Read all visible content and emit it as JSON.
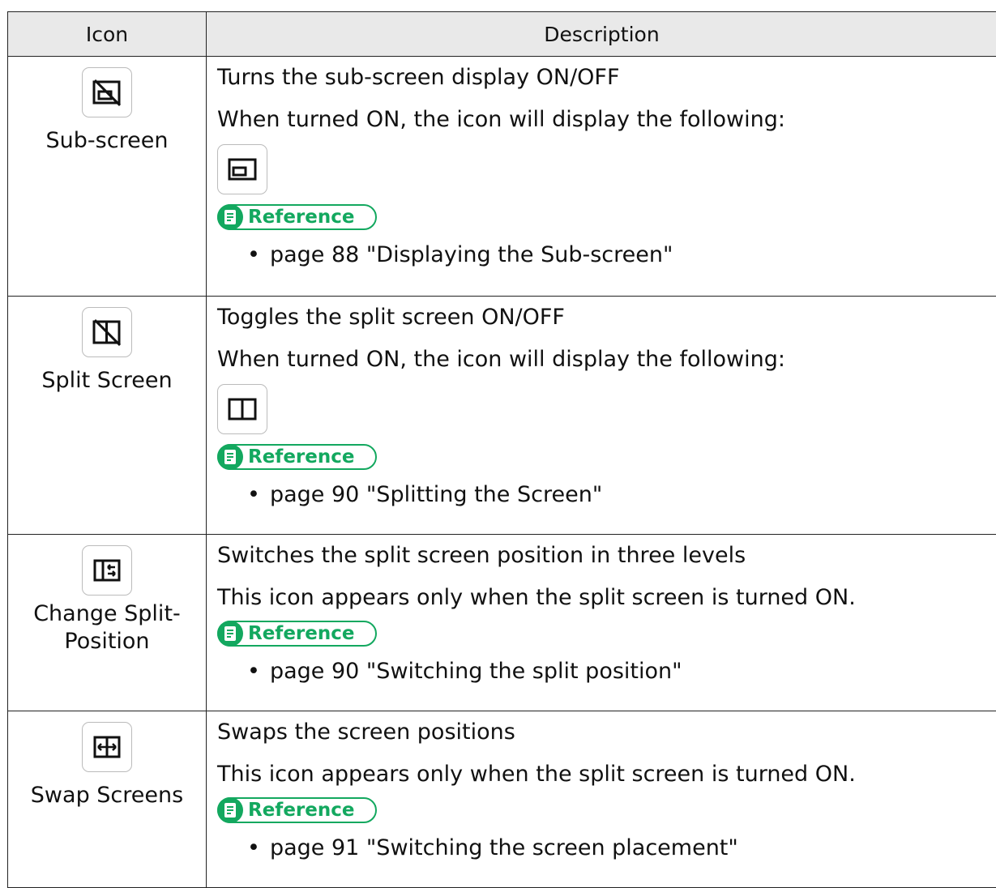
{
  "table": {
    "headers": {
      "icon": "Icon",
      "description": "Description"
    },
    "rows": [
      {
        "icon": "sub-screen-off-icon",
        "name": "Sub-screen",
        "lines": [
          "Turns the sub-screen display ON/OFF",
          "When turned ON, the icon will display the following:"
        ],
        "on_icon": "sub-screen-on-icon",
        "reference_label": "Reference",
        "reference": "page 88 \"Displaying the Sub-screen\""
      },
      {
        "icon": "split-screen-off-icon",
        "name": "Split Screen",
        "lines": [
          "Toggles the split screen ON/OFF",
          "When turned ON, the icon will display the following:"
        ],
        "on_icon": "split-screen-on-icon",
        "reference_label": "Reference",
        "reference": "page 90 \"Splitting the Screen\""
      },
      {
        "icon": "change-split-position-icon",
        "name": "Change Split-Position",
        "lines": [
          "Switches the split screen position in three levels",
          "This icon appears only when the split screen is turned ON."
        ],
        "reference_label": "Reference",
        "reference": "page 90 \"Switching the split position\""
      },
      {
        "icon": "swap-screens-icon",
        "name": "Swap Screens",
        "lines": [
          "Swaps the screen positions",
          "This icon appears only when the split screen is turned ON."
        ],
        "reference_label": "Reference",
        "reference": "page 91 \"Switching the screen placement\""
      }
    ]
  },
  "colors": {
    "reference_green": "#13a85f",
    "header_bg": "#e9e9e9"
  }
}
